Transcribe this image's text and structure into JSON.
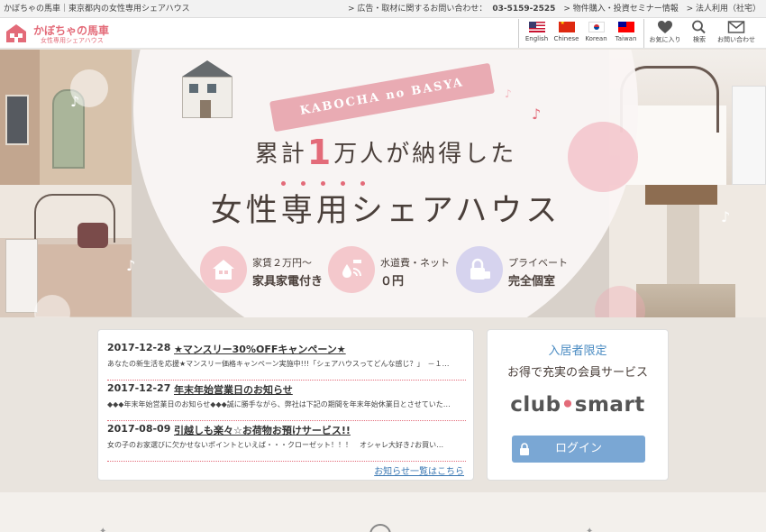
{
  "topbar": {
    "left": "かぼちゃの馬車｜東京都内の女性専用シェアハウス",
    "link_ad": "> 広告・取材に関するお問い合わせ：",
    "tel": "03-5159-2525",
    "link_seminar": "> 物件購入・投資セミナー情報",
    "link_corp": "> 法人利用（社宅）"
  },
  "header": {
    "logo_name": "かぼちゃの馬車",
    "logo_sub": "女性専用シェアハウス",
    "languages": [
      "English",
      "Chinese",
      "Korean",
      "Taiwan"
    ],
    "icons": {
      "favorite": "お気に入り",
      "search": "検索",
      "contact": "お問い合わせ"
    }
  },
  "hero": {
    "ribbon": "KABOCHA no BASYA",
    "catch_pre": "累計",
    "catch_num": "1",
    "catch_post": "万人が納得した",
    "catch_main": "女性専用シェアハウス",
    "features": [
      {
        "line1": "家賃２万円～",
        "line2": "家具家電付き",
        "icon": "house-icon"
      },
      {
        "line1": "水道費・ネット",
        "line2": "０円",
        "icon": "water-wifi-icon"
      },
      {
        "line1": "プライベート",
        "line2": "完全個室",
        "icon": "lock-icon"
      }
    ]
  },
  "news": {
    "items": [
      {
        "date": "2017-12-28",
        "title": "★マンスリー30%OFFキャンペーン★",
        "text": "あなたの新生活を応援★マンスリー価格キャンペーン実施中!!!「シェアハウスってどんな感じ？」　－１…"
      },
      {
        "date": "2017-12-27",
        "title": "年末年始営業日のお知らせ",
        "text": "◆◆◆年末年始営業日のお知らせ◆◆◆誠に勝手ながら、弊社は下記の期間を年末年始休業日とさせていた…"
      },
      {
        "date": "2017-08-09",
        "title": "引越しも楽々☆お荷物お預けサービス!!",
        "text": "女の子のお家選びに欠かせないポイントといえば・・・クローゼット！！！　オシャレ大好き♪お買い…"
      }
    ],
    "more": "お知らせ一覧はこちら"
  },
  "member": {
    "label": "入居者限定",
    "title": "お得で充実の会員サービス",
    "logo_a": "club",
    "logo_dot": "•",
    "logo_b": "smart",
    "login": "ログイン"
  },
  "colors": {
    "accent": "#e36b79",
    "login": "#7aa7d4",
    "link": "#3b78b3"
  }
}
